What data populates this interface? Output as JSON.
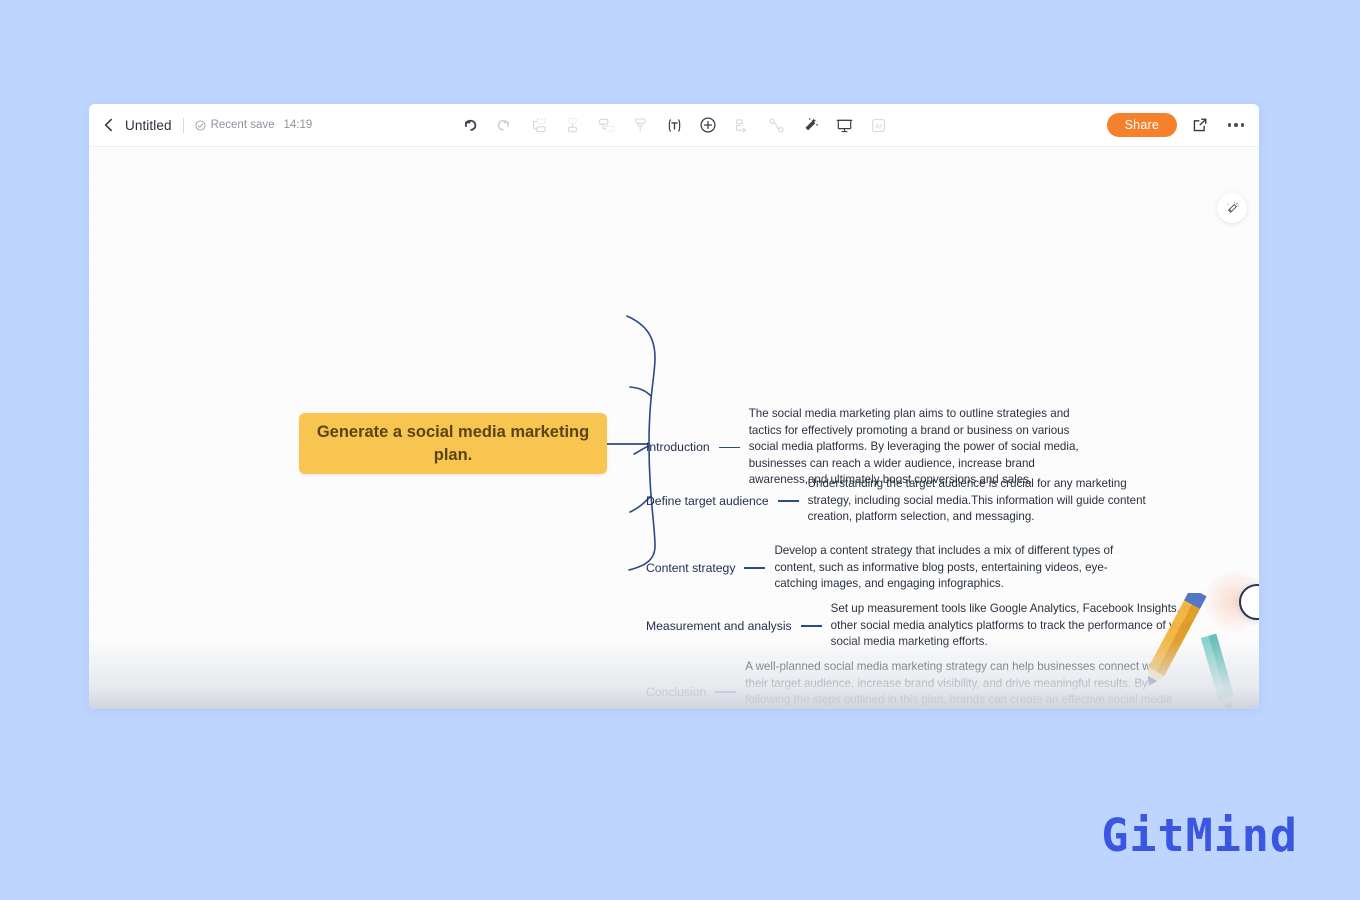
{
  "window": {
    "header": {
      "back_icon": "chevron-left-icon",
      "title": "Untitled",
      "save_check_icon": "check-circle-icon",
      "save_label": "Recent save",
      "save_time": "14:19",
      "toolbar": [
        {
          "name": "undo",
          "icon": "undo-arrow-icon",
          "state": "active"
        },
        {
          "name": "redo",
          "icon": "redo-arrow-icon",
          "state": "dim"
        },
        {
          "name": "insert-sibling-node",
          "icon": "sibling-node-icon",
          "state": "dim"
        },
        {
          "name": "insert-child-node",
          "icon": "child-node-icon",
          "state": "dim"
        },
        {
          "name": "insert-subtopic",
          "icon": "subtopic-node-icon",
          "state": "dim"
        },
        {
          "name": "format-painter",
          "icon": "format-painter-icon",
          "state": "dim"
        },
        {
          "name": "text-style",
          "icon": "text-bracket-icon",
          "state": "active"
        },
        {
          "name": "add-element",
          "icon": "plus-circle-icon",
          "state": "active"
        },
        {
          "name": "relation-line",
          "icon": "relation-arrow-icon",
          "state": "dim"
        },
        {
          "name": "connector-curve",
          "icon": "curve-link-icon",
          "state": "dim"
        },
        {
          "name": "magic-wand",
          "icon": "magic-wand-icon",
          "state": "active"
        },
        {
          "name": "presentation",
          "icon": "presentation-icon",
          "state": "active"
        },
        {
          "name": "ai-assistant",
          "icon": "ai-badge-icon",
          "state": "dim"
        }
      ],
      "share_label": "Share",
      "export_icon": "export-arrow-icon",
      "more_icon": "more-dots-icon"
    },
    "canvas": {
      "wand_fab_icon": "magic-wand-icon",
      "edge_fab_icon": "round-fab-icon"
    }
  },
  "mindmap": {
    "central_node": "Generate a social media marketing plan.",
    "branches": [
      {
        "label": "Introduction",
        "body": "The social media marketing plan aims to outline strategies and tactics for effectively promoting a brand or business on various social media platforms. By leveraging the power of social media, businesses can reach a wider audience, increase brand awareness,and ultimately boost conversions and sales."
      },
      {
        "label": "Define target audience",
        "body": "Understanding the target audience is crucial for any marketing strategy, including social media.This information will guide content creation, platform selection, and messaging."
      },
      {
        "label": "Content strategy",
        "body": "Develop a content strategy that includes a mix of different types of content, such as informative blog posts, entertaining videos, eye-catching images, and engaging infographics."
      },
      {
        "label": "Measurement and analysis",
        "body": "Set up measurement tools like Google Analytics, Facebook Insights, or other social media analytics platforms to track the performance of your social media marketing efforts."
      },
      {
        "label": "Conclusion",
        "body": "A well-planned social media marketing strategy can help businesses connect with their target audience, increase brand visibility, and drive meaningful results. By following the steps outlined in this plan, brands can create an effective social media presence that contributes to their overall marketing goals."
      }
    ]
  },
  "branding": {
    "wordmark": "GitMind"
  },
  "colors": {
    "page_background": "#bdd5ff",
    "central_node": "#f8c551",
    "central_node_text": "#5b4413",
    "branch_line": "#2c4a84",
    "share_button": "#f5822a",
    "wordmark": "#3b56e0"
  }
}
